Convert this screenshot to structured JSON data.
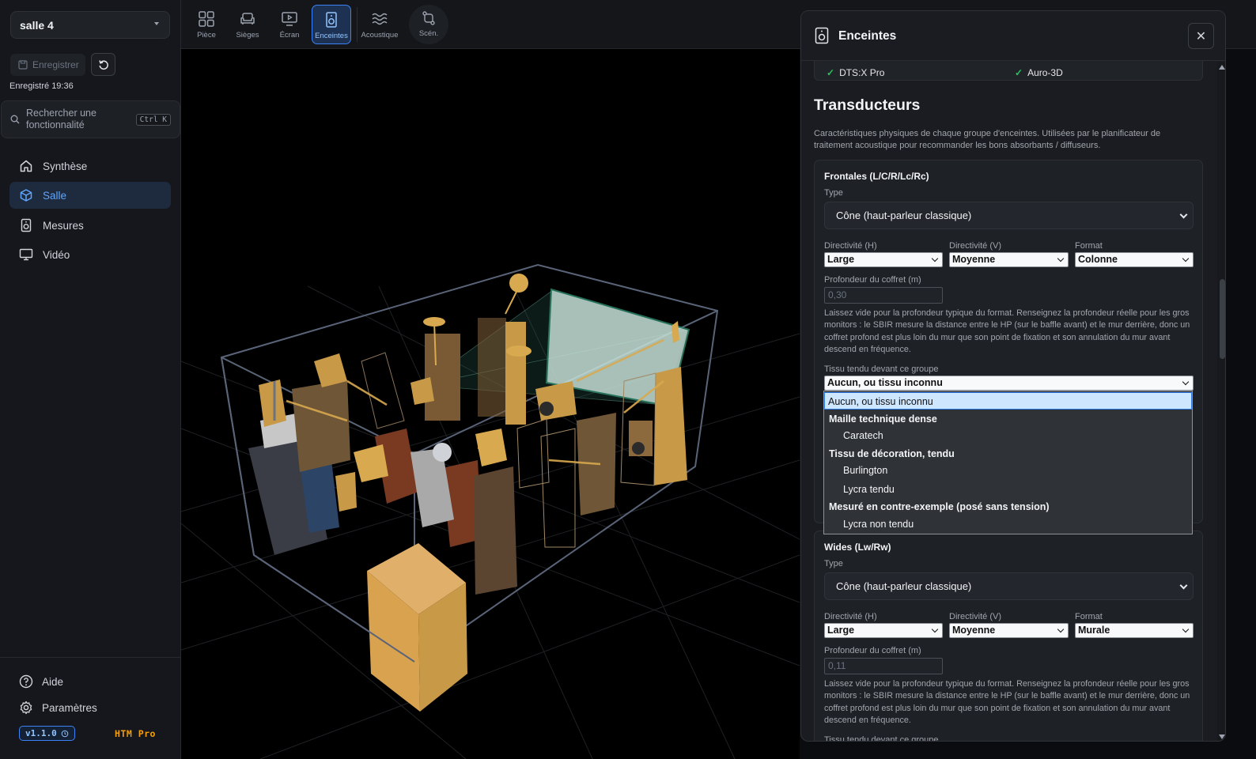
{
  "sidebar": {
    "room": "salle 4",
    "save_label": "Enregistrer",
    "saved_at": "Enregistré 19:36",
    "search_placeholder": "Rechercher une fonctionnalité",
    "search_shortcut": "Ctrl K",
    "nav": [
      {
        "label": "Synthèse",
        "icon": "home-icon"
      },
      {
        "label": "Salle",
        "icon": "cube-icon",
        "active": true
      },
      {
        "label": "Mesures",
        "icon": "speaker-icon"
      },
      {
        "label": "Vidéo",
        "icon": "monitor-icon"
      }
    ],
    "help_label": "Aide",
    "settings_label": "Paramètres",
    "version": "v1.1.0",
    "plan": "HTM Pro"
  },
  "toolbar": {
    "tools": [
      {
        "label": "Pièce",
        "icon": "grid-icon"
      },
      {
        "label": "Sièges",
        "icon": "sofa-icon"
      },
      {
        "label": "Écran",
        "icon": "screen-icon"
      },
      {
        "label": "Enceintes",
        "icon": "speaker-icon",
        "active": true
      },
      {
        "label": "Acoustique",
        "icon": "waves-icon"
      },
      {
        "label": "Scén.",
        "icon": "scenario-icon"
      }
    ]
  },
  "panel": {
    "title": "Enceintes",
    "formats": [
      "DTS:X Pro",
      "Auro-3D"
    ],
    "section_title": "Transducteurs",
    "section_desc": "Caractéristiques physiques de chaque groupe d'enceintes. Utilisées par le planificateur de traitement acoustique pour recommander les bons absorbants / diffuseurs.",
    "labels": {
      "type": "Type",
      "dir_h": "Directivité (H)",
      "dir_v": "Directivité (V)",
      "format": "Format",
      "depth": "Profondeur du coffret (m)",
      "fabric": "Tissu tendu devant ce groupe"
    },
    "depth_hint": "Laissez vide pour la profondeur typique du format. Renseignez la profondeur réelle pour les gros monitors : le SBIR mesure la distance entre le HP (sur le baffle avant) et le mur derrière, donc un coffret profond est plus loin du mur que son point de fixation et son annulation du mur avant descend en fréquence.",
    "groups": [
      {
        "title": "Frontales (L/C/R/Lc/Rc)",
        "type": "Cône (haut-parleur classique)",
        "dir_h": "Large",
        "dir_v": "Moyenne",
        "format": "Colonne",
        "depth_placeholder": "0,30",
        "fabric": "Aucun, ou tissu inconnu"
      },
      {
        "title": "Wides (Lw/Rw)",
        "type": "Cône (haut-parleur classique)",
        "dir_h": "Large",
        "dir_v": "Moyenne",
        "format": "Murale",
        "depth_placeholder": "0,11"
      }
    ],
    "fabric_options": [
      {
        "kind": "sel",
        "label": "Aucun, ou tissu inconnu"
      },
      {
        "kind": "grp",
        "label": "Maille technique dense"
      },
      {
        "kind": "opt",
        "label": "Caratech"
      },
      {
        "kind": "grp",
        "label": "Tissu de décoration, tendu"
      },
      {
        "kind": "opt",
        "label": "Burlington"
      },
      {
        "kind": "opt",
        "label": "Lycra tendu"
      },
      {
        "kind": "grp",
        "label": "Mesuré en contre-exemple (posé sans tension)"
      },
      {
        "kind": "opt",
        "label": "Lycra non tendu"
      }
    ]
  },
  "colors": {
    "accent": "#3b82f6",
    "background": "#15171c",
    "plan": "#f59e0b",
    "check": "#22c55e"
  }
}
